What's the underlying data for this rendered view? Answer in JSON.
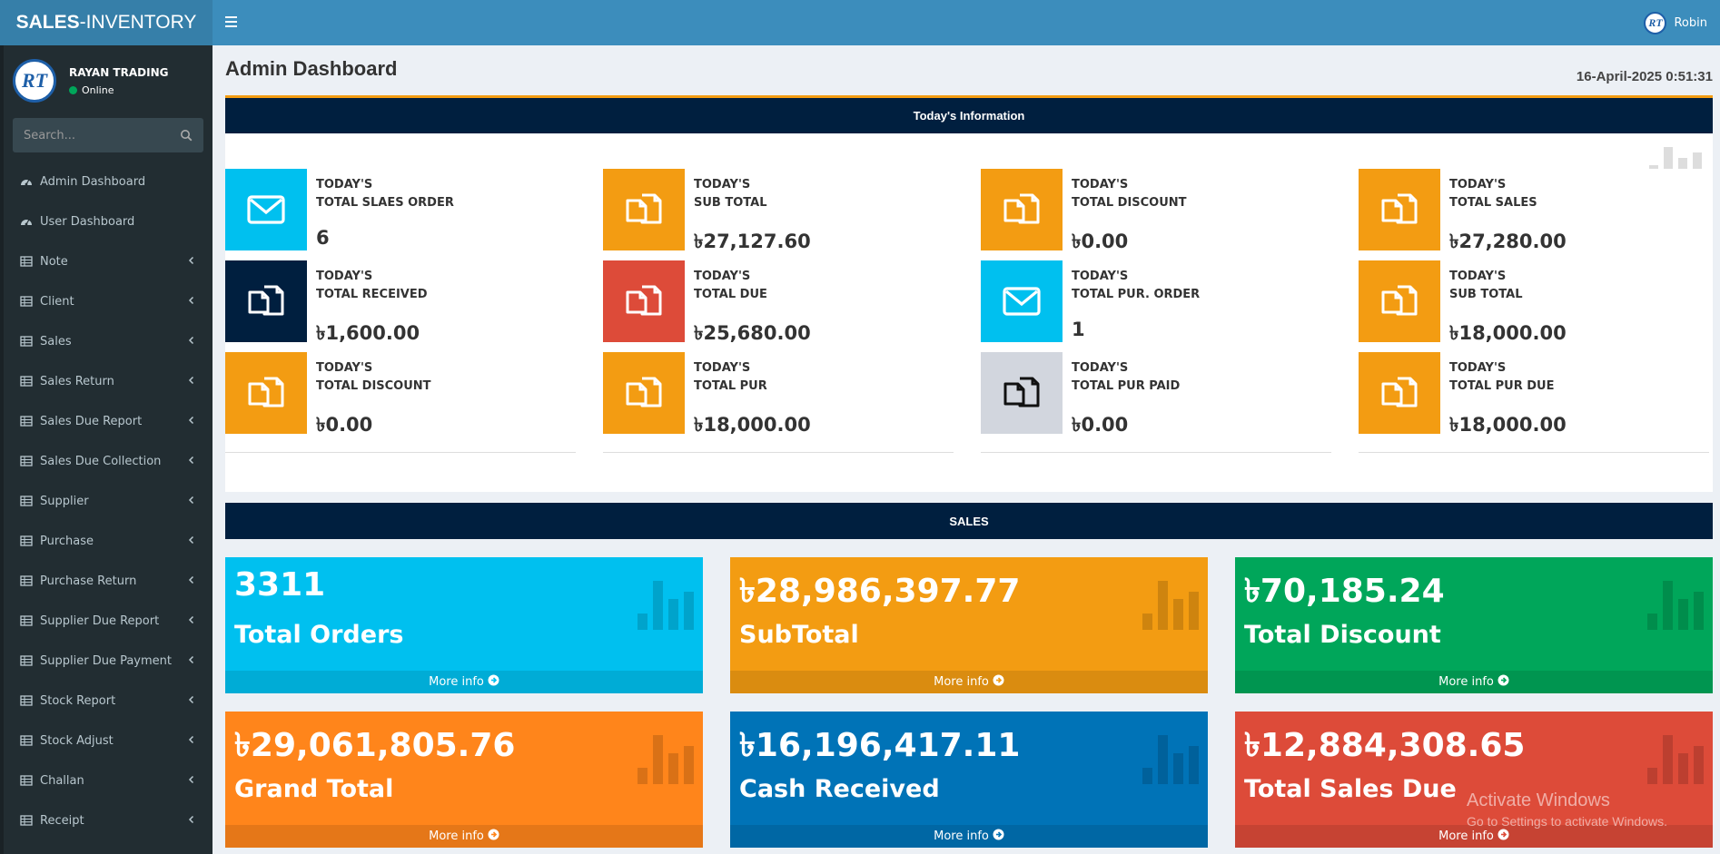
{
  "brand": {
    "bold": "SALES",
    "rest": "-INVENTORY"
  },
  "header": {
    "user_name": "Robin",
    "user_initials": "RT"
  },
  "sidebar": {
    "company": "RAYAN TRADING",
    "status": "Online",
    "avatar_initials": "RT",
    "search_placeholder": "Search...",
    "items": [
      {
        "label": "Admin Dashboard",
        "icon": "dashboard-icon",
        "submenu": false
      },
      {
        "label": "User Dashboard",
        "icon": "dashboard-icon",
        "submenu": false
      },
      {
        "label": "Note",
        "icon": "table-icon",
        "submenu": true
      },
      {
        "label": "Client",
        "icon": "table-icon",
        "submenu": true
      },
      {
        "label": "Sales",
        "icon": "table-icon",
        "submenu": true
      },
      {
        "label": "Sales Return",
        "icon": "table-icon",
        "submenu": true
      },
      {
        "label": "Sales Due Report",
        "icon": "table-icon",
        "submenu": true
      },
      {
        "label": "Sales Due Collection",
        "icon": "table-icon",
        "submenu": true
      },
      {
        "label": "Supplier",
        "icon": "table-icon",
        "submenu": true
      },
      {
        "label": "Purchase",
        "icon": "table-icon",
        "submenu": true
      },
      {
        "label": "Purchase Return",
        "icon": "table-icon",
        "submenu": true
      },
      {
        "label": "Supplier Due Report",
        "icon": "table-icon",
        "submenu": true
      },
      {
        "label": "Supplier Due Payment",
        "icon": "table-icon",
        "submenu": true
      },
      {
        "label": "Stock Report",
        "icon": "table-icon",
        "submenu": true
      },
      {
        "label": "Stock Adjust",
        "icon": "table-icon",
        "submenu": true
      },
      {
        "label": "Challan",
        "icon": "table-icon",
        "submenu": true
      },
      {
        "label": "Receipt",
        "icon": "table-icon",
        "submenu": true
      }
    ]
  },
  "page": {
    "title": "Admin Dashboard",
    "datetime": "16-April-2025 0:51:31"
  },
  "today": {
    "header": "Today's Information",
    "boxes": [
      {
        "line1": "TODAY'S",
        "line2": "TOTAL SLAES ORDER",
        "value": "6",
        "icon": "envelope-icon",
        "color": "#00c0ef"
      },
      {
        "line1": "TODAY'S",
        "line2": "SUB TOTAL",
        "value": "৳27,127.60",
        "icon": "copy-icon",
        "color": "#f39c12"
      },
      {
        "line1": "TODAY'S",
        "line2": "TOTAL DISCOUNT",
        "value": "৳0.00",
        "icon": "copy-icon",
        "color": "#f39c12"
      },
      {
        "line1": "TODAY'S",
        "line2": "TOTAL SALES",
        "value": "৳27,280.00",
        "icon": "copy-icon",
        "color": "#f39c12"
      },
      {
        "line1": "TODAY'S",
        "line2": "TOTAL RECEIVED",
        "value": "৳1,600.00",
        "icon": "copy-icon",
        "color": "#001f3f"
      },
      {
        "line1": "TODAY'S",
        "line2": "TOTAL DUE",
        "value": "৳25,680.00",
        "icon": "copy-icon",
        "color": "#dd4b39"
      },
      {
        "line1": "TODAY'S",
        "line2": "TOTAL PUR. ORDER",
        "value": "1",
        "icon": "envelope-icon",
        "color": "#00c0ef"
      },
      {
        "line1": "TODAY'S",
        "line2": "SUB TOTAL",
        "value": "৳18,000.00",
        "icon": "copy-icon",
        "color": "#f39c12"
      },
      {
        "line1": "TODAY'S",
        "line2": "TOTAL DISCOUNT",
        "value": "৳0.00",
        "icon": "copy-icon",
        "color": "#f39c12"
      },
      {
        "line1": "TODAY'S",
        "line2": "TOTAL PUR",
        "value": "৳18,000.00",
        "icon": "copy-icon",
        "color": "#f39c12"
      },
      {
        "line1": "TODAY'S",
        "line2": "TOTAL PUR PAID",
        "value": "৳0.00",
        "icon": "copy-icon",
        "color": "#d2d6de"
      },
      {
        "line1": "TODAY'S",
        "line2": "TOTAL PUR DUE",
        "value": "৳18,000.00",
        "icon": "copy-icon",
        "color": "#f39c12"
      }
    ]
  },
  "sales": {
    "header": "SALES",
    "more_info": "More info",
    "tiles": [
      {
        "value": "3311",
        "label": "Total Orders",
        "color": "#00c0ef"
      },
      {
        "value": "৳28,986,397.77",
        "label": "SubTotal",
        "color": "#f39c12"
      },
      {
        "value": "৳70,185.24",
        "label": "Total Discount",
        "color": "#00a65a"
      },
      {
        "value": "৳29,061,805.76",
        "label": "Grand Total",
        "color": "#ff851b"
      },
      {
        "value": "৳16,196,417.11",
        "label": "Cash Received",
        "color": "#0073b7"
      },
      {
        "value": "৳12,884,308.65",
        "label": "Total Sales Due",
        "color": "#dd4b39"
      }
    ]
  },
  "watermark": {
    "title": "Activate Windows",
    "subtitle": "Go to Settings to activate Windows."
  }
}
